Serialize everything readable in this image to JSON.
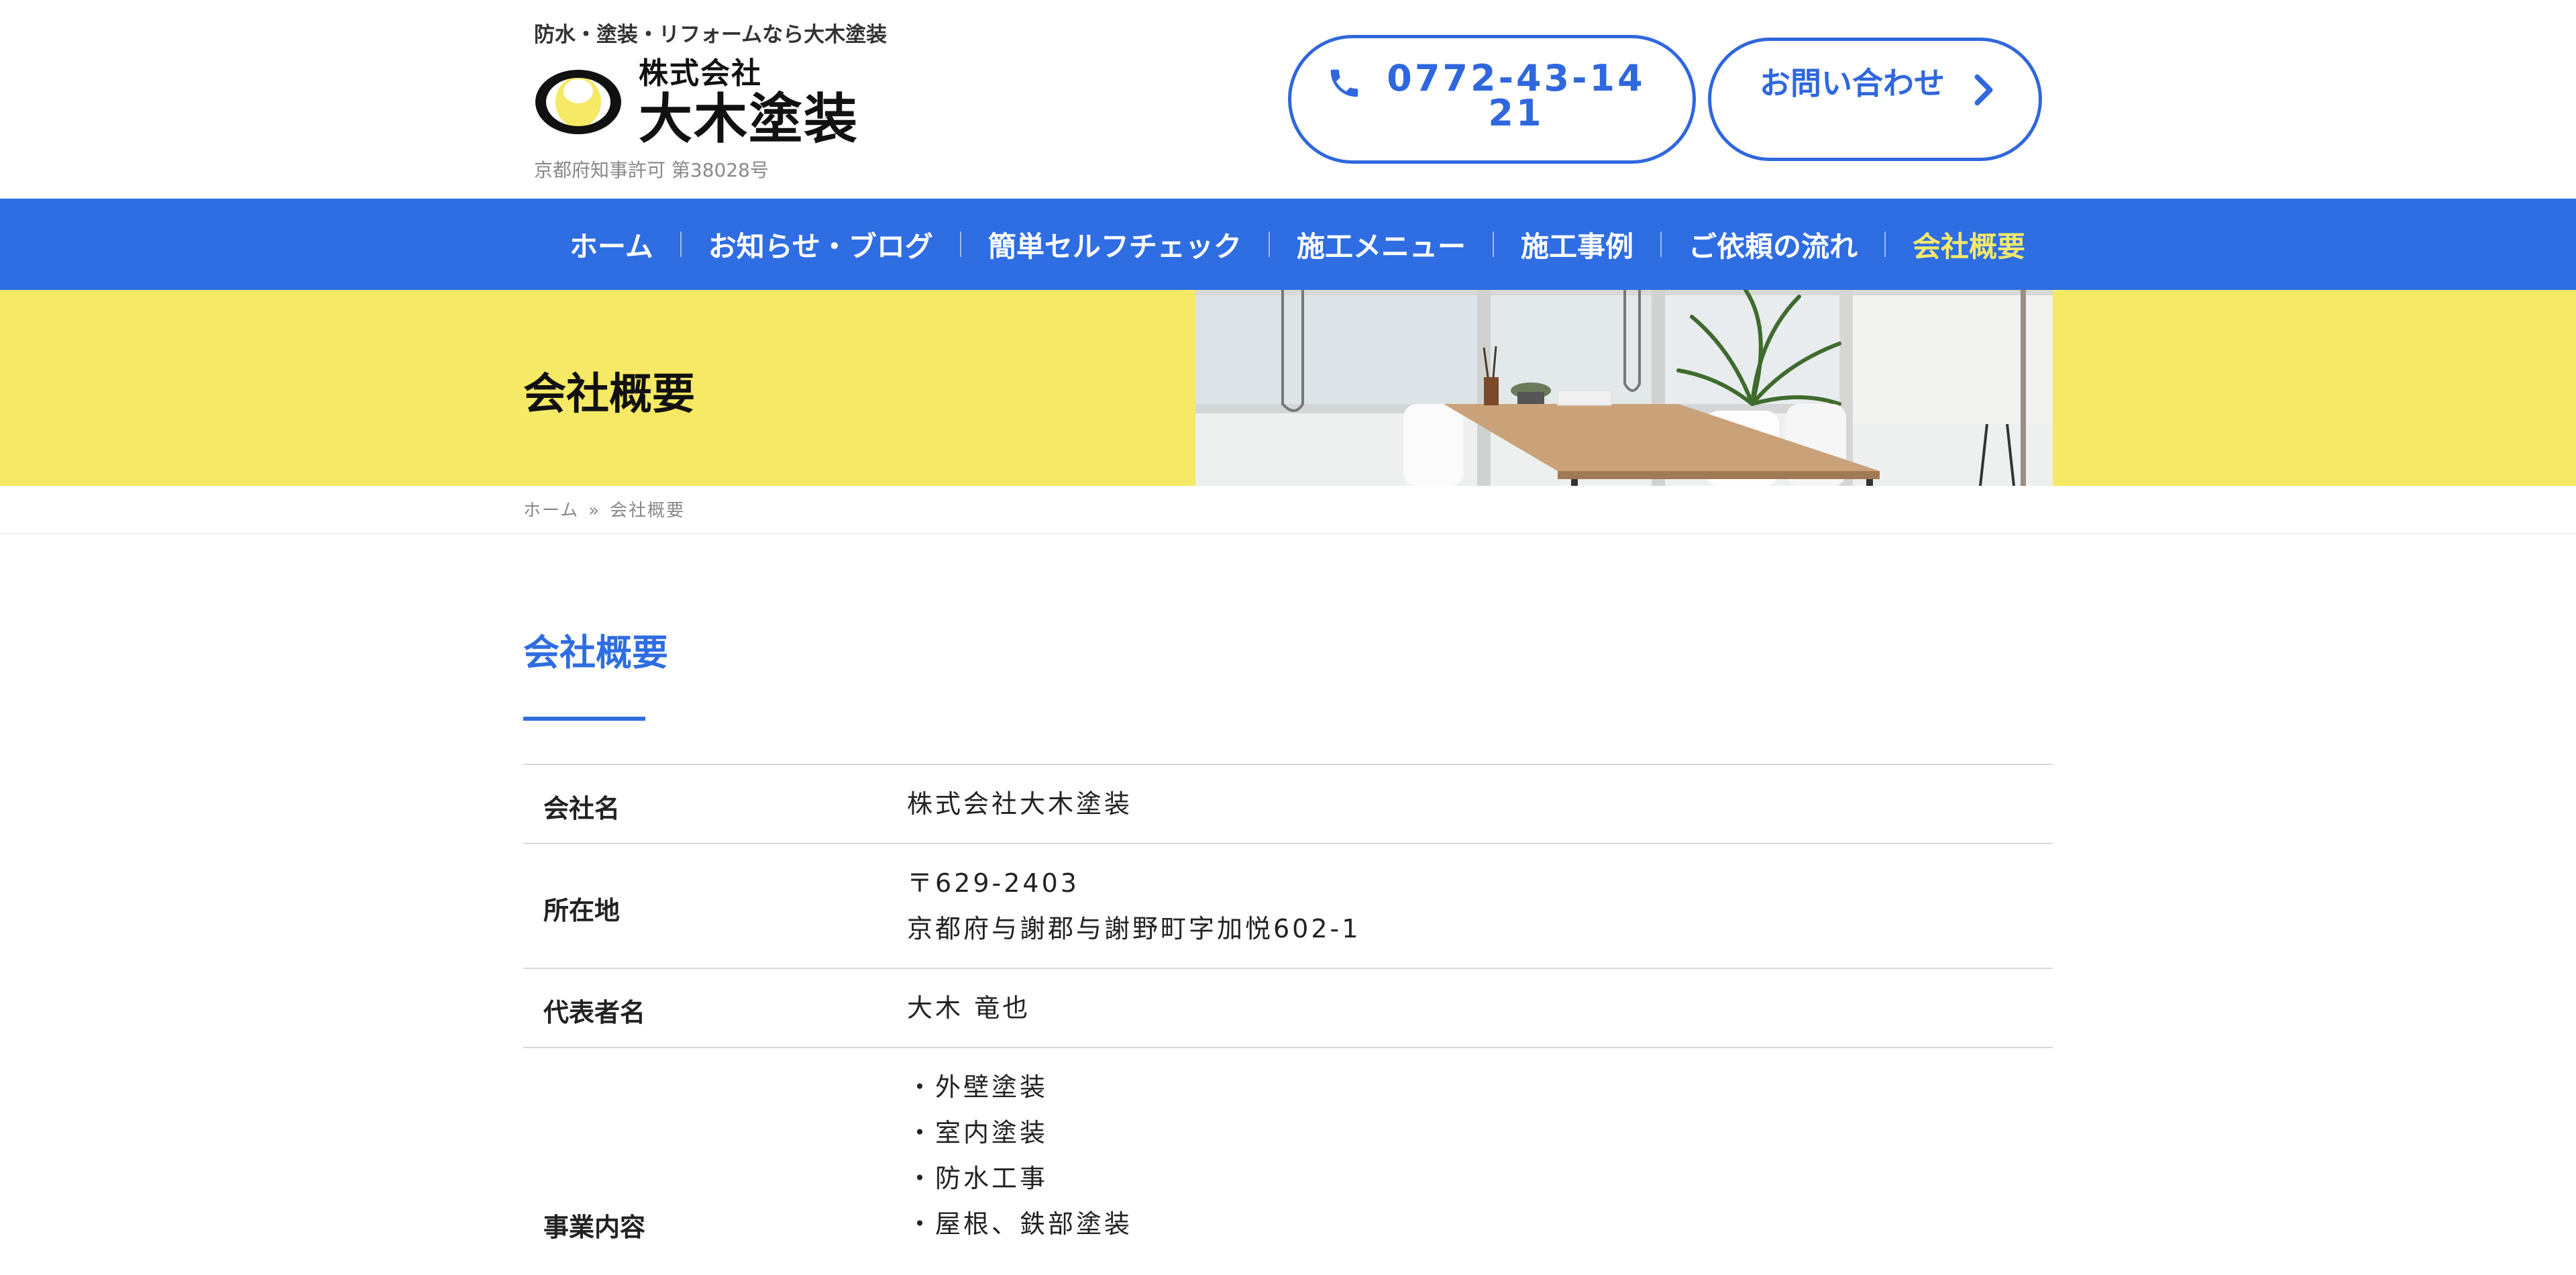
{
  "header": {
    "tagline": "防水・塗装・リフォームなら大木塗装",
    "logo_small": "株式会社",
    "logo_big": "大木塗装",
    "license": "京都府知事許可 第38028号",
    "phone_label": "0772-43-1421",
    "contact_label": "お問い合わせ"
  },
  "nav": {
    "items": [
      {
        "label": "ホーム"
      },
      {
        "label": "お知らせ・ブログ"
      },
      {
        "label": "簡単セルフチェック"
      },
      {
        "label": "施工メニュー"
      },
      {
        "label": "施工事例"
      },
      {
        "label": "ご依頼の流れ"
      },
      {
        "label": "会社概要"
      }
    ],
    "active_index": 6
  },
  "hero": {
    "title": "会社概要"
  },
  "breadcrumb": {
    "home": "ホーム",
    "separator": "»",
    "current": "会社概要"
  },
  "section": {
    "title": "会社概要"
  },
  "company_info": {
    "rows": [
      {
        "label": "会社名",
        "lines": [
          "株式会社大木塗装"
        ]
      },
      {
        "label": "所在地",
        "lines": [
          "〒629-2403",
          "京都府与謝郡与謝野町字加悦602-1"
        ]
      },
      {
        "label": "代表者名",
        "lines": [
          "大木 竜也"
        ]
      },
      {
        "label": "事業内容",
        "lines": [
          "・外壁塗装",
          "・室内塗装",
          "・防水工事",
          "・屋根、鉄部塗装"
        ]
      }
    ]
  },
  "colors": {
    "brand_blue": "#2f6de2",
    "hero_yellow": "#f5e965",
    "nav_active": "#f4e96b"
  },
  "icons": {
    "phone": "phone-icon",
    "chevron": "chevron-right-icon",
    "logo": "logo-mark"
  }
}
